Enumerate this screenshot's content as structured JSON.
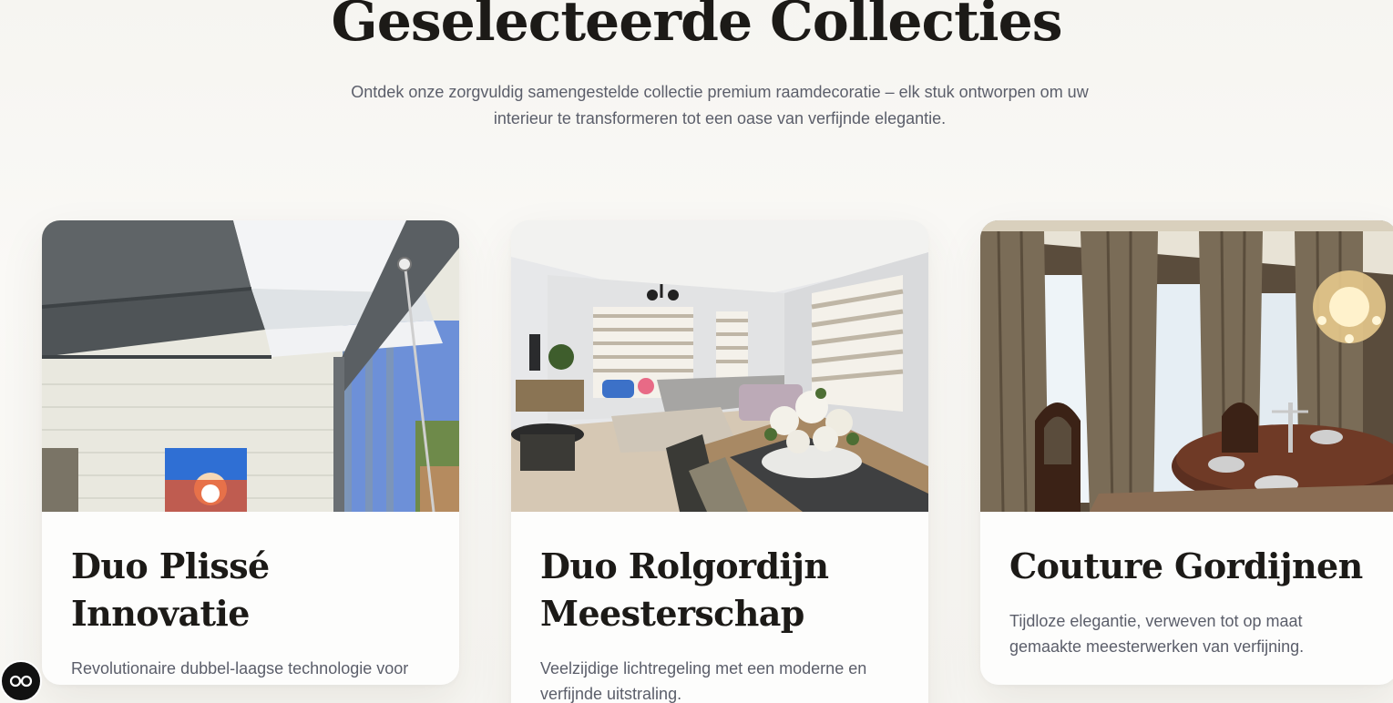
{
  "section": {
    "title": "Geselecteerde Collecties",
    "subtitle": "Ontdek onze zorgvuldig samengestelde collectie premium raamdecoratie – elk stuk ontworpen om uw interieur te transformeren tot een oase van verfijnde elegantie."
  },
  "cards": [
    {
      "title": "Duo Plissé Innovatie",
      "description": "Revolutionaire dubbel-laagse technologie voor optimale lichtregeling.",
      "image": "conservatory-pleated-blinds-photo"
    },
    {
      "title": "Duo Rolgordijn Meesterschap",
      "description": "Veelzijdige lichtregeling met een moderne en verfijnde uitstraling.",
      "image": "living-room-duo-roller-blinds-photo"
    },
    {
      "title": "Couture Gordijnen",
      "description": "Tijdloze elegantie, verweven tot op maat gemaakte meesterwerken van verfijning.",
      "image": "dining-room-curtains-photo"
    }
  ],
  "accessibility_button": {
    "icon": "accessibility-glasses-icon"
  }
}
